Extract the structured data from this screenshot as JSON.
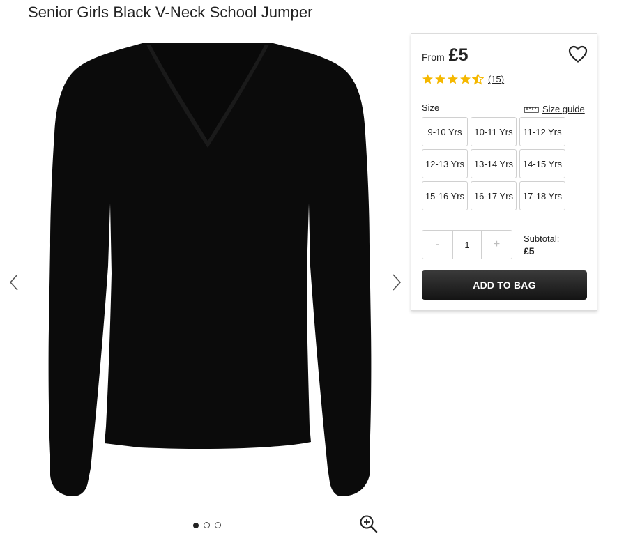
{
  "product": {
    "title": "Senior Girls Black V-Neck School Jumper",
    "price_prefix": "From",
    "price": "£5",
    "rating": 4.5,
    "rating_max": 5,
    "review_count": "(15)",
    "image_icon": "black-v-neck-jumper"
  },
  "gallery": {
    "prev_icon": "chevron-left-icon",
    "next_icon": "chevron-right-icon",
    "slides_total": 3,
    "active_slide": 1,
    "zoom_icon": "zoom-in-icon"
  },
  "size": {
    "label": "Size",
    "guide_label": "Size guide",
    "guide_icon": "ruler-icon",
    "options": [
      "9-10 Yrs",
      "10-11 Yrs",
      "11-12 Yrs",
      "12-13 Yrs",
      "13-14 Yrs",
      "14-15 Yrs",
      "15-16 Yrs",
      "16-17 Yrs",
      "17-18 Yrs"
    ]
  },
  "quantity": {
    "decrement": "-",
    "value": "1",
    "increment": "+"
  },
  "subtotal": {
    "label": "Subtotal:",
    "value": "£5"
  },
  "cta": {
    "add_to_bag": "ADD TO BAG"
  },
  "colors": {
    "star": "#f5b800",
    "button_dark": "#1a1a1a"
  }
}
